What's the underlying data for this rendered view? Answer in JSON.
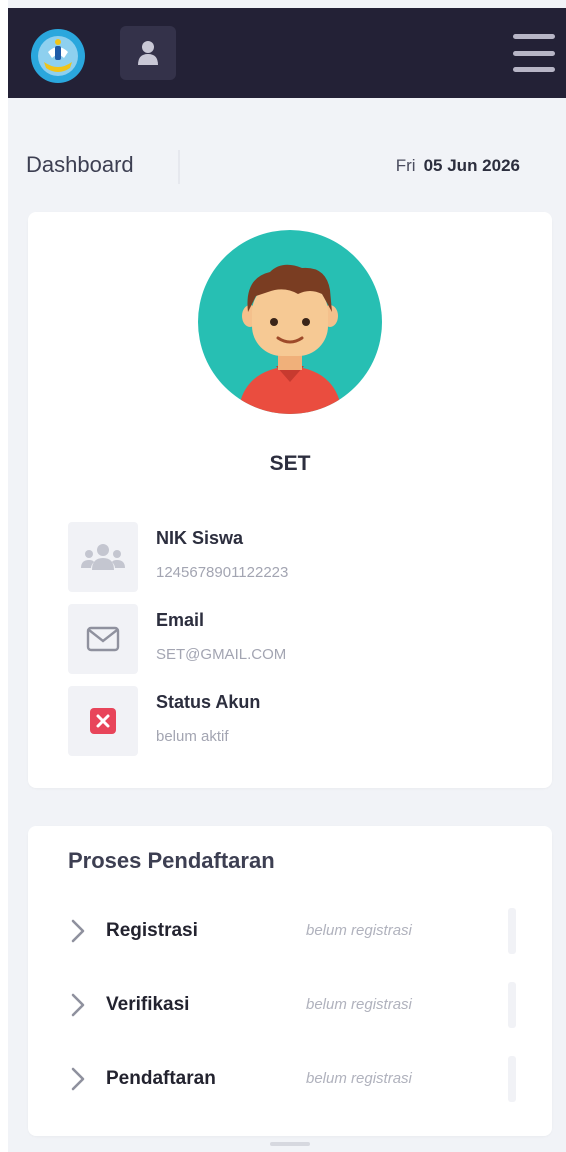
{
  "header": {
    "logo_icon": "tut-wuri-handayani-logo",
    "user_icon": "user-icon",
    "menu_icon": "hamburger-menu-icon"
  },
  "dashboard": {
    "title": "Dashboard",
    "day": "Fri",
    "date": "05 Jun 2026"
  },
  "profile": {
    "avatar_icon": "male-avatar",
    "name": "SET",
    "fields": [
      {
        "label": "NIK Siswa",
        "value": "1245678901122223",
        "icon": "users-icon"
      },
      {
        "label": "Email",
        "value": "SET@GMAIL.COM",
        "icon": "envelope-icon"
      },
      {
        "label": "Status Akun",
        "value": "belum aktif",
        "icon": "x-status-icon"
      }
    ]
  },
  "process": {
    "title": "Proses Pendaftaran",
    "steps": [
      {
        "label": "Registrasi",
        "status": "belum registrasi"
      },
      {
        "label": "Verifikasi",
        "status": "belum registrasi"
      },
      {
        "label": "Pendaftaran",
        "status": "belum registrasi"
      }
    ]
  },
  "colors": {
    "topbar": "#232136",
    "avatar_bg": "#27bfb3",
    "status_red": "#e8455a",
    "page_bg": "#f1f3f7"
  }
}
